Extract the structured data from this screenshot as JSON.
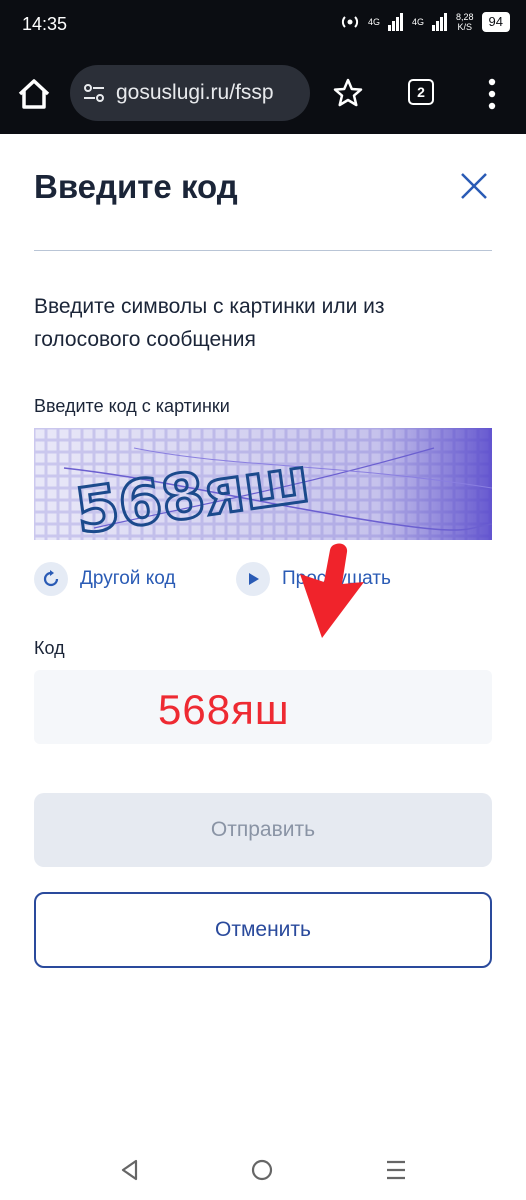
{
  "status_bar": {
    "time": "14:35",
    "network_1": "4G",
    "network_2": "4G",
    "speed_value": "8,28",
    "speed_unit": "K/S",
    "battery": "94"
  },
  "browser": {
    "url": "gosuslugi.ru/fssp",
    "tab_count": "2"
  },
  "dialog": {
    "title": "Введите код",
    "description": "Введите символы с картинки или из голосового сообщения",
    "captcha_label": "Введите код с картинки",
    "captcha_text": "568яш",
    "refresh_label": "Другой код",
    "listen_label": "Прослушать",
    "code_label": "Код",
    "code_value": "568яш",
    "submit_label": "Отправить",
    "cancel_label": "Отменить"
  },
  "colors": {
    "accent": "#2a4a9c",
    "link": "#2a5bb5",
    "annotation_arrow": "#f0232b",
    "code_text": "#ee2a32"
  },
  "icons": {
    "home": "home-icon",
    "site_settings": "tune-icon",
    "bookmark": "star-icon",
    "menu": "more-vert-icon",
    "close": "close-icon",
    "refresh": "refresh-icon",
    "play": "play-icon"
  }
}
